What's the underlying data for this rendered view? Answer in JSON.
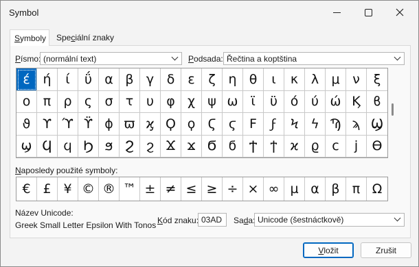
{
  "window": {
    "title": "Symbol"
  },
  "tabs": {
    "symbols": {
      "prefix": "",
      "accel": "S",
      "rest": "ymboly"
    },
    "special": {
      "prefix": "Spe",
      "accel": "c",
      "rest": "iální znaky"
    }
  },
  "font": {
    "label_accel": "P",
    "label_rest": "ísmo:",
    "value": "(normální text)"
  },
  "subset": {
    "label_accel": "P",
    "label_rest": "odsada:",
    "value": "Řečtina a koptština"
  },
  "symbols": [
    "έ",
    "ή",
    "ί",
    "ΰ",
    "α",
    "β",
    "γ",
    "δ",
    "ε",
    "ζ",
    "η",
    "θ",
    "ι",
    "κ",
    "λ",
    "μ",
    "ν",
    "ξ",
    "ο",
    "π",
    "ρ",
    "ς",
    "σ",
    "τ",
    "υ",
    "φ",
    "χ",
    "ψ",
    "ω",
    "ϊ",
    "ϋ",
    "ό",
    "ύ",
    "ώ",
    "Ϗ",
    "ϐ",
    "ϑ",
    "ϒ",
    "ϓ",
    "ϔ",
    "ϕ",
    "ϖ",
    "ϗ",
    "Ϙ",
    "ϙ",
    "Ϛ",
    "ϛ",
    "Ϝ",
    "ϝ",
    "Ϟ",
    "ϟ",
    "Ϡ",
    "ϡ",
    "Ϣ",
    "ϣ",
    "Ϥ",
    "ϥ",
    "Ϧ",
    "ϧ",
    "Ϩ",
    "ϩ",
    "Ϫ",
    "ϫ",
    "Ϭ",
    "ϭ",
    "Ϯ",
    "ϯ",
    "ϰ",
    "ϱ",
    "ϲ",
    "ϳ",
    "ϴ"
  ],
  "selected_index": 0,
  "recent": {
    "label_accel": "N",
    "label_rest": "aposledy použité symboly:",
    "items": [
      "€",
      "£",
      "¥",
      "©",
      "®",
      "™",
      "±",
      "≠",
      "≤",
      "≥",
      "÷",
      "×",
      "∞",
      "µ",
      "α",
      "β",
      "π",
      "Ω"
    ]
  },
  "unicode_name": {
    "label": "Název Unicode:",
    "value": "Greek Small Letter Epsilon With Tonos"
  },
  "char_code": {
    "label_accel": "K",
    "label_rest": "ód znaku:",
    "value": "03AD"
  },
  "from": {
    "label_prefix": "Sa",
    "label_accel": "d",
    "label_rest": "a:",
    "value": "Unicode (šestnáctkově)"
  },
  "buttons": {
    "insert": {
      "prefix": "",
      "accel": "V",
      "rest": "ložit"
    },
    "cancel": "Zrušit"
  },
  "colors": {
    "selection": "#0067c0",
    "background": "#f3f3f3"
  },
  "icons": {
    "minimize": "minimize-icon",
    "maximize": "maximize-icon",
    "close": "close-icon",
    "dropdown": "chevron-down-icon"
  }
}
